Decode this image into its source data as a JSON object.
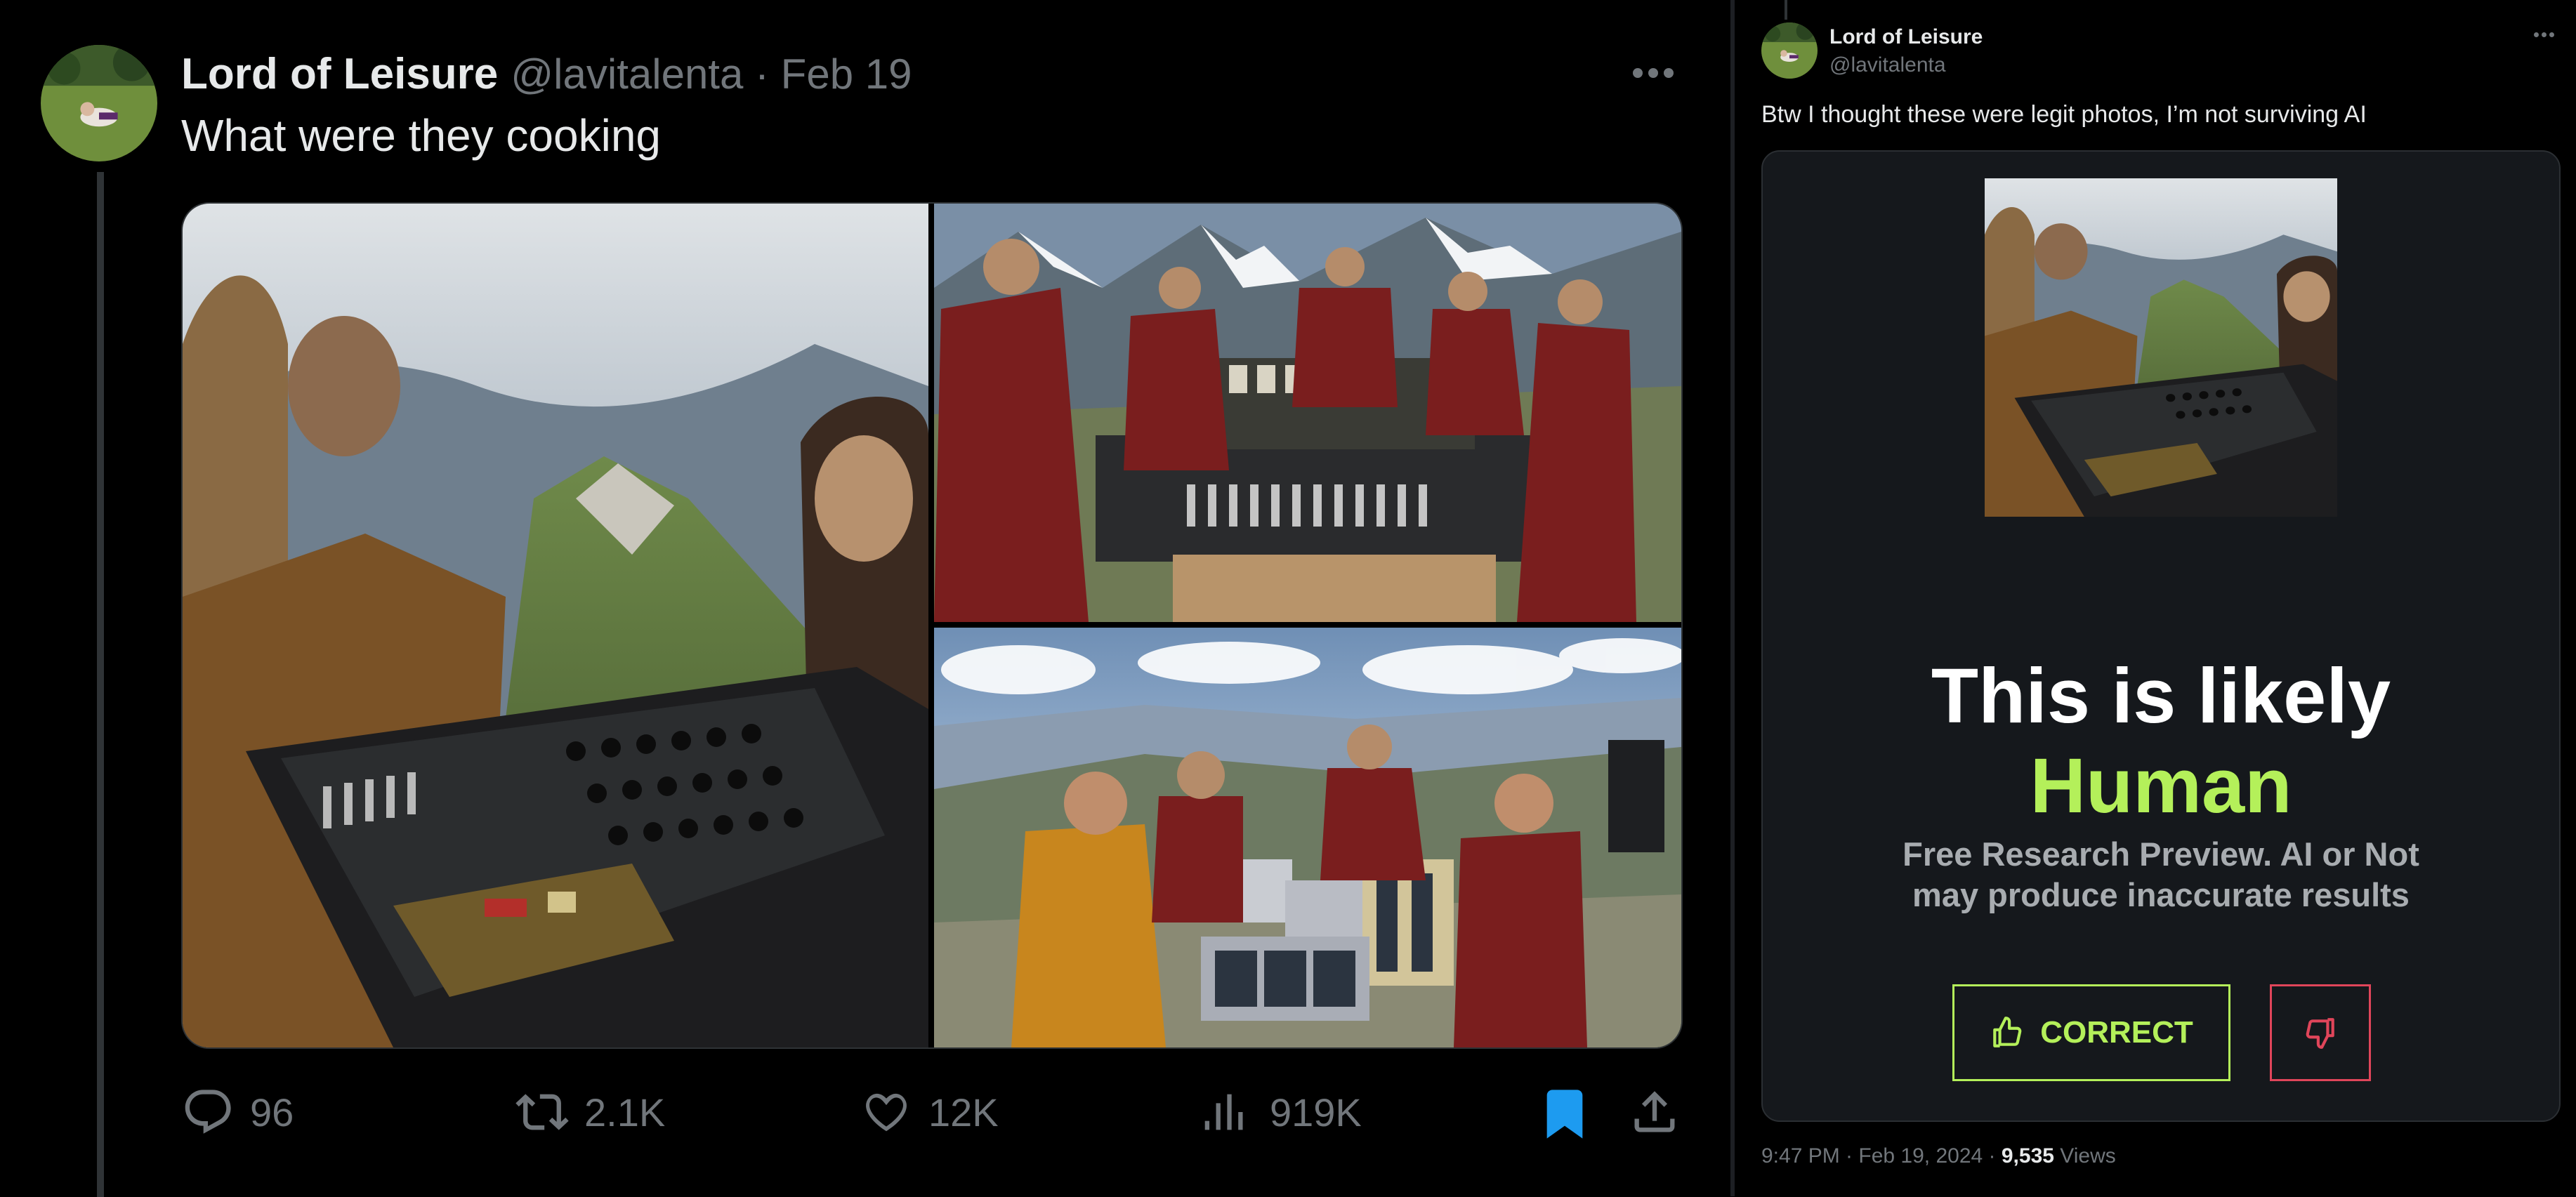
{
  "tweet": {
    "display_name": "Lord of Leisure",
    "handle": "@lavitalenta",
    "date": "Feb 19",
    "handle_and_date": "@lavitalenta · Feb 19",
    "text": "What were they cooking",
    "stats": {
      "replies": "96",
      "retweets": "2.1K",
      "likes": "12K",
      "views": "919K"
    }
  },
  "quote_panel": {
    "display_name": "Lord of Leisure",
    "handle": "@lavitalenta",
    "text": "Btw I thought these were legit photos, I’m not surviving AI",
    "result_line1": "This is likely",
    "result_line2": "Human",
    "disclaimer_line1": "Free Research Preview. AI or Not",
    "disclaimer_line2": "may produce inaccurate results",
    "correct_label": "CORRECT",
    "timestamp": "9:47 PM · Feb 19, 2024 · ",
    "views_count": "9,535",
    "views_label": " Views"
  },
  "colors": {
    "accent_green": "#b4f05a",
    "wrong_red": "#e0455a",
    "bookmark_blue": "#1d9bf0",
    "muted": "#71767b"
  },
  "icons": [
    "reply-icon",
    "retweet-icon",
    "like-icon",
    "views-icon",
    "bookmark-icon",
    "share-icon",
    "more-icon",
    "thumbs-up-icon",
    "thumbs-down-icon"
  ]
}
